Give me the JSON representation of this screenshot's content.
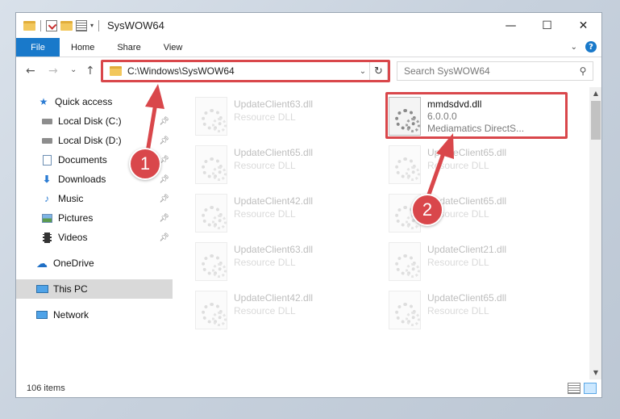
{
  "window": {
    "title": "SysWOW64",
    "controls": {
      "minimize": "—",
      "maximize": "☐",
      "close": "✕"
    }
  },
  "ribbon": {
    "tabs": [
      "File",
      "Home",
      "Share",
      "View"
    ],
    "help": "?"
  },
  "navigation": {
    "back": "←",
    "forward": "→",
    "recent": "⌄",
    "up": "↑",
    "address": "C:\\Windows\\SysWOW64",
    "refresh": "↻",
    "search_placeholder": "Search SysWOW64"
  },
  "sidebar": {
    "items": [
      {
        "label": "Quick access",
        "icon": "star-icon",
        "pinned": false
      },
      {
        "label": "Local Disk (C:)",
        "icon": "drive-icon",
        "pinned": true
      },
      {
        "label": "Local Disk (D:)",
        "icon": "drive-icon",
        "pinned": true
      },
      {
        "label": "Documents",
        "icon": "documents-icon",
        "pinned": true
      },
      {
        "label": "Downloads",
        "icon": "download-icon",
        "pinned": true
      },
      {
        "label": "Music",
        "icon": "music-icon",
        "pinned": true
      },
      {
        "label": "Pictures",
        "icon": "pictures-icon",
        "pinned": true
      },
      {
        "label": "Videos",
        "icon": "videos-icon",
        "pinned": true
      },
      {
        "label": "OneDrive",
        "icon": "cloud-icon",
        "pinned": false
      },
      {
        "label": "This PC",
        "icon": "computer-icon",
        "pinned": false
      },
      {
        "label": "Network",
        "icon": "network-icon",
        "pinned": false
      }
    ]
  },
  "files": {
    "highlighted": {
      "name": "mmdsdvd.dll",
      "version": "6.0.0.0",
      "description": "Mediamatics DirectS..."
    },
    "left_column": [
      {
        "name": "UpdateClient63.dll",
        "type": "Resource DLL"
      },
      {
        "name": "UpdateClient65.dll",
        "type": "Resource DLL"
      },
      {
        "name": "UpdateClient42.dll",
        "type": "Resource DLL"
      },
      {
        "name": "UpdateClient63.dll",
        "type": "Resource DLL"
      },
      {
        "name": "UpdateClient42.dll",
        "type": "Resource DLL"
      }
    ],
    "right_column": [
      {
        "name": "UpdateClient65.dll",
        "type": "Resource DLL"
      },
      {
        "name": "UpdateClient65.dll",
        "type": "Resource DLL"
      },
      {
        "name": "UpdateClient21.dll",
        "type": "Resource DLL"
      },
      {
        "name": "UpdateClient65.dll",
        "type": "Resource DLL"
      }
    ]
  },
  "status": {
    "item_count": "106 items"
  },
  "annotations": {
    "step1": "1",
    "step2": "2",
    "color": "#d9474b"
  }
}
